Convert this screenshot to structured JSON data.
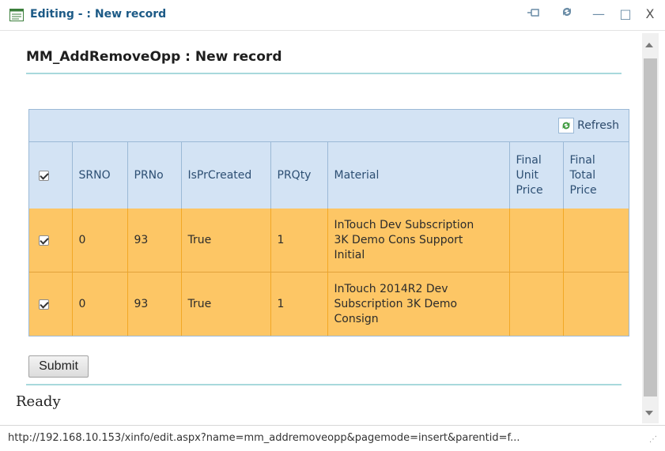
{
  "window": {
    "title": "Editing - : New record",
    "controls": {
      "pin": "pin-icon",
      "refresh": "refresh-icon",
      "minimize": "—",
      "maximize": "□",
      "close": "X"
    }
  },
  "form": {
    "heading": "MM_AddRemoveOpp : New record"
  },
  "grid": {
    "refresh_label": "Refresh",
    "columns": [
      {
        "label": ""
      },
      {
        "label": "SRNO"
      },
      {
        "label": "PRNo"
      },
      {
        "label": "IsPrCreated"
      },
      {
        "label": "PRQty"
      },
      {
        "label": "Material"
      },
      {
        "label": "Final\nUnit\nPrice"
      },
      {
        "label": "Final\nTotal\nPrice"
      }
    ],
    "header_checked": true,
    "rows": [
      {
        "checked": true,
        "srno": "0",
        "prno": "93",
        "isprcreated": "True",
        "prqty": "1",
        "material": "InTouch Dev Subscription\n3K Demo Cons Support\nInitial",
        "unit_price": "",
        "total_price": ""
      },
      {
        "checked": true,
        "srno": "0",
        "prno": "93",
        "isprcreated": "True",
        "prqty": "1",
        "material": "InTouch 2014R2 Dev\nSubscription 3K Demo\nConsign",
        "unit_price": "",
        "total_price": ""
      }
    ]
  },
  "actions": {
    "submit_label": "Submit"
  },
  "status": {
    "text": "Ready"
  },
  "statusbar": {
    "url": "http://192.168.10.153/xinfo/edit.aspx?name=mm_addremoveopp&pagemode=insert&parentid=f..."
  },
  "colors": {
    "accent": "#1c5a86",
    "header_bg": "#d3e3f4",
    "row_bg": "#fdc665",
    "rule": "#a8d9dc"
  }
}
